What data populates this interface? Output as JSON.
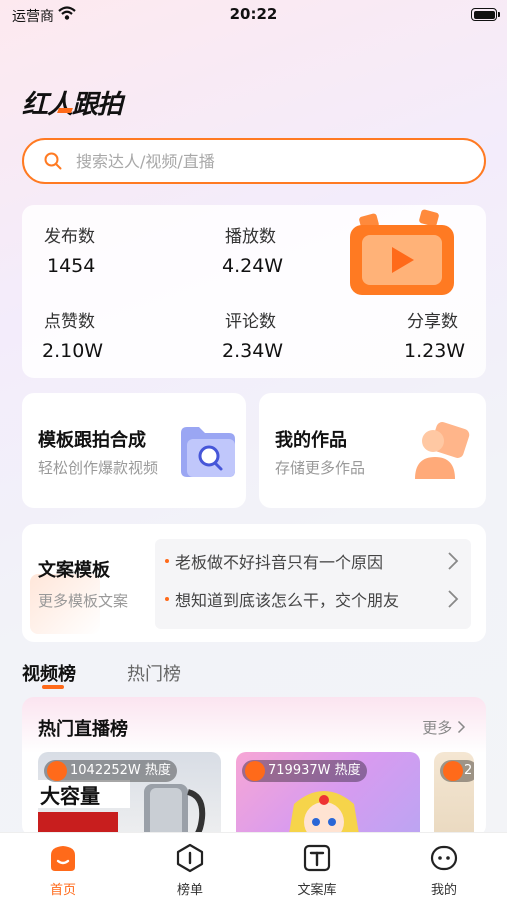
{
  "status_bar": {
    "carrier": "运营商",
    "time": "20:22"
  },
  "app": {
    "logo_text": "红人跟拍"
  },
  "search": {
    "placeholder": "搜索达人/视频/直播"
  },
  "stats": [
    {
      "label": "发布数",
      "value": "1454"
    },
    {
      "label": "播放数",
      "value": "4.24W"
    },
    {
      "label": "点赞数",
      "value": "2.10W"
    },
    {
      "label": "评论数",
      "value": "2.34W"
    },
    {
      "label": "分享数",
      "value": "1.23W"
    }
  ],
  "template_card": {
    "title": "模板跟拍合成",
    "subtitle": "轻松创作爆款视频"
  },
  "works_card": {
    "title": "我的作品",
    "subtitle": "存储更多作品"
  },
  "copy_card": {
    "title": "文案模板",
    "subtitle": "更多模板文案",
    "lines": [
      "老板做不好抖音只有一个原因",
      "想知道到底该怎么干，交个朋友"
    ]
  },
  "tabs": [
    {
      "label": "视频榜"
    },
    {
      "label": "热门榜"
    }
  ],
  "live": {
    "title": "热门直播榜",
    "more": "更多",
    "tiles": [
      {
        "heat": "1042252W 热度"
      },
      {
        "heat": "719937W 热度"
      },
      {
        "heat": "2"
      }
    ],
    "tile1_text": "大容量"
  },
  "bottom_nav": [
    {
      "label": "首页"
    },
    {
      "label": "榜单"
    },
    {
      "label": "文案库"
    },
    {
      "label": "我的"
    }
  ],
  "colors": {
    "accent": "#ff6a1a"
  }
}
